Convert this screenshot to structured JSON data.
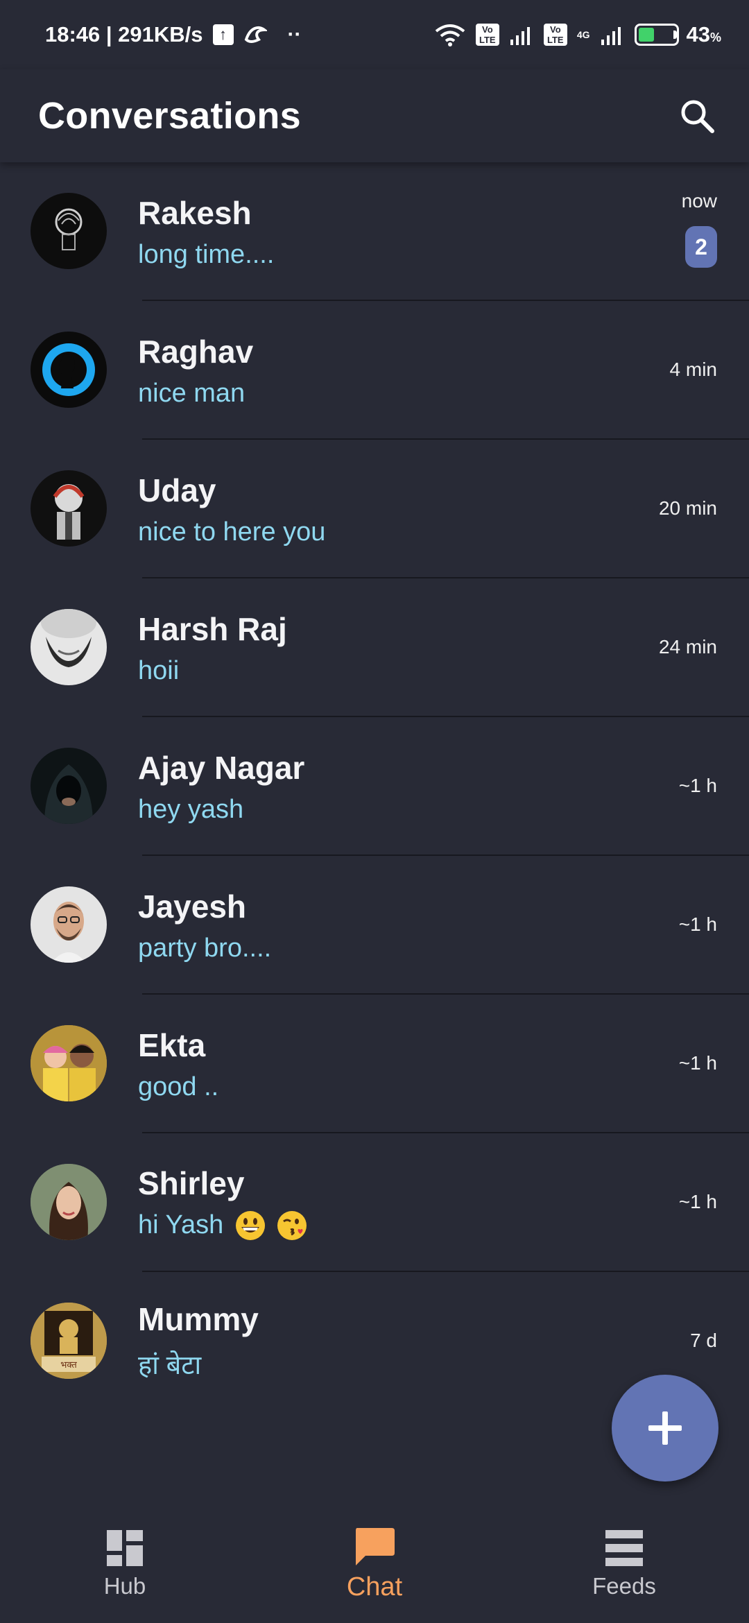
{
  "status_bar": {
    "time_speed": "18:46 | 291KB/s",
    "battery_pct": "43",
    "battery_level": 0.43,
    "net_label_1": "Vo LTE",
    "net_label_2": "4G"
  },
  "header": {
    "title": "Conversations"
  },
  "conversations": [
    {
      "name": "Rakesh",
      "message": "long time....",
      "time": "now",
      "unread": "2"
    },
    {
      "name": "Raghav",
      "message": "nice man",
      "time": "4 min"
    },
    {
      "name": "Uday",
      "message": "nice to here you",
      "time": "20 min"
    },
    {
      "name": "Harsh Raj",
      "message": "hoii",
      "time": "24 min"
    },
    {
      "name": "Ajay Nagar",
      "message": "hey yash",
      "time": "~1 h"
    },
    {
      "name": "Jayesh",
      "message": "party bro....",
      "time": "~1 h"
    },
    {
      "name": "Ekta",
      "message": "good ..",
      "time": "~1 h"
    },
    {
      "name": "Shirley",
      "message": "hi Yash",
      "time": "~1 h"
    },
    {
      "name": "Mummy",
      "message": "हां बेटा",
      "time": "7 d"
    }
  ],
  "nav": {
    "hub": "Hub",
    "chat": "Chat",
    "feeds": "Feeds"
  },
  "colors": {
    "background": "#282a36",
    "accent": "#6274b4",
    "message_text": "#8fd8f0",
    "active_nav": "#f7a15e"
  }
}
